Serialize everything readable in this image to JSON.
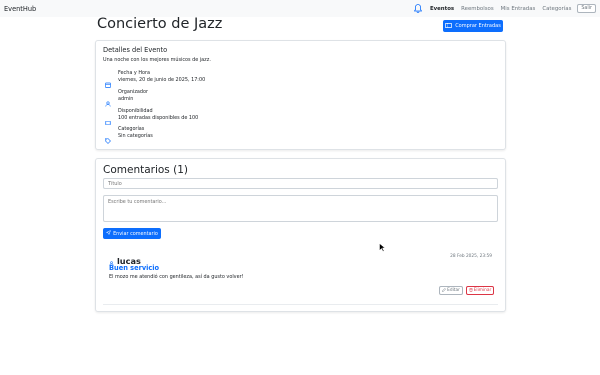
{
  "navbar": {
    "brand": "EventHub",
    "links": [
      "Eventos",
      "Reembolsos",
      "Mis Entradas",
      "Categorías"
    ],
    "logout_label": "Salir"
  },
  "event": {
    "title": "Concierto de Jazz",
    "buy_label": "Comprar Entradas",
    "details_heading": "Detalles del Evento",
    "description": "Una noche con los mejores músicos de jazz.",
    "info": [
      {
        "icon": "calendar-icon",
        "label": "Fecha y Hora",
        "value": "viernes, 20 de junio de 2025, 17:00"
      },
      {
        "icon": "user-icon",
        "label": "Organizador",
        "value": "admin"
      },
      {
        "icon": "ticket-icon",
        "label": "Disponibilidad",
        "value": "100 entradas disponibles de 100"
      },
      {
        "icon": "tag-icon",
        "label": "Categorías",
        "value": "Sin categorías"
      }
    ]
  },
  "comments": {
    "heading": "Comentarios (1)",
    "title_placeholder": "Título",
    "body_placeholder": "Escribe tu comentario...",
    "submit_label": "Enviar comentario",
    "items": [
      {
        "author": "lucas",
        "timestamp": "28 Feb 2025, 23:59",
        "title": "Buen servicio",
        "body": "El mozo me atendió con gentileza, así da gusto volver!",
        "edit_label": "Editar",
        "delete_label": "Eliminar"
      }
    ]
  },
  "colors": {
    "primary": "#0d6efd",
    "danger": "#dc3545",
    "navbar_bg": "#f8f9fa"
  }
}
